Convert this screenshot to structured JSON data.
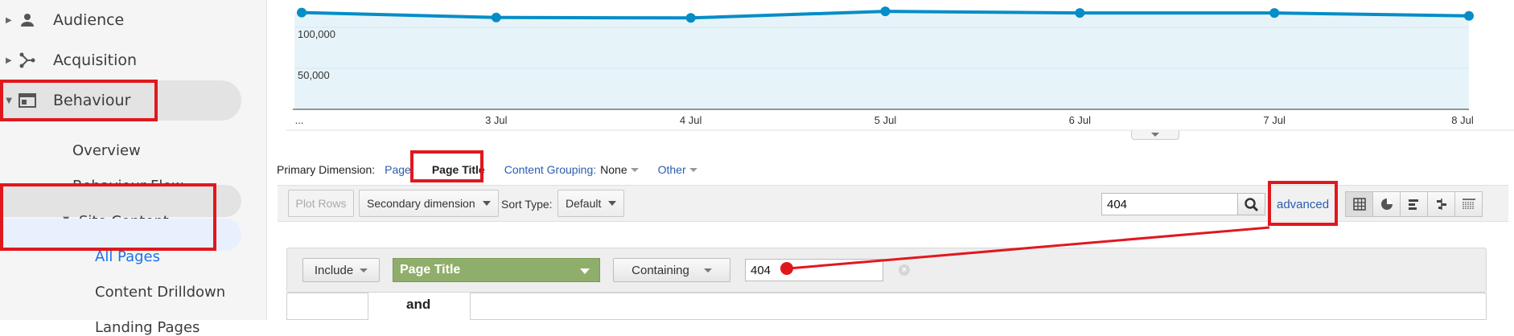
{
  "sidebar": {
    "audience": "Audience",
    "acquisition": "Acquisition",
    "behaviour": "Behaviour",
    "overview": "Overview",
    "behaviour_flow": "Behaviour Flow",
    "site_content": "Site Content",
    "all_pages": "All Pages",
    "content_drilldown": "Content Drilldown",
    "landing_pages": "Landing Pages"
  },
  "chart": {
    "y_ticks": [
      "100,000",
      "50,000"
    ],
    "x_ticks": [
      "...",
      "3 Jul",
      "4 Jul",
      "5 Jul",
      "6 Jul",
      "7 Jul",
      "8 Jul"
    ],
    "line_color": "#058dc7",
    "fill_color": "#e6f4fa"
  },
  "chart_data": {
    "type": "area",
    "categories": [
      "...",
      "3 Jul",
      "4 Jul",
      "5 Jul",
      "6 Jul",
      "7 Jul",
      "8 Jul"
    ],
    "values": [
      118000,
      112000,
      111500,
      119500,
      117500,
      117500,
      114000
    ],
    "ylim": [
      0,
      130000
    ],
    "grid": true
  },
  "dimension_row": {
    "primary_label": "Primary Dimension:",
    "page": "Page",
    "page_title": "Page Title",
    "content_grouping": "Content Grouping:",
    "content_grouping_value": "None",
    "other": "Other"
  },
  "toolbar": {
    "plot_rows": "Plot Rows",
    "secondary_dimension": "Secondary dimension",
    "sort_type_label": "Sort Type:",
    "sort_type_value": "Default",
    "search_value": "404",
    "advanced": "advanced"
  },
  "filter": {
    "include": "Include",
    "dimension": "Page Title",
    "match_type": "Containing",
    "value": "404",
    "and": "and"
  },
  "annotation_color": "#e0181e"
}
